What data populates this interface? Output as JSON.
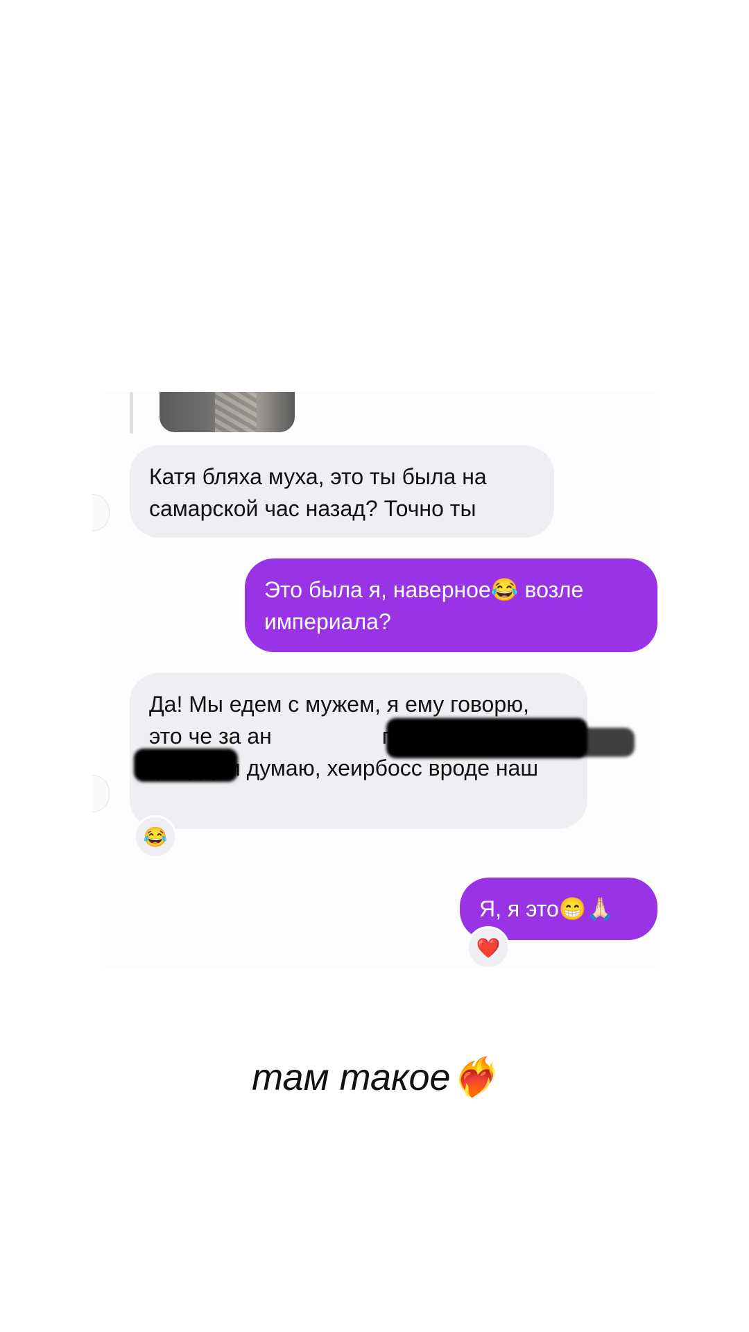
{
  "chat": {
    "messages": [
      {
        "sender": "them",
        "text": "Катя бляха муха, это ты была на самарской час назад? Точно ты"
      },
      {
        "sender": "me",
        "text": "Это была я, наверное😂 возле империала?"
      },
      {
        "sender": "them",
        "text": "Да! Мы едем с мужем, я ему говорю, это че за ан",
        "text_after_redaction": "потом смотрю на фигуру и думаю, хеирбосс вроде наш",
        "reaction": "😂"
      },
      {
        "sender": "me",
        "text": "Я, я это😁🙏🏻",
        "reaction": "❤️"
      }
    ]
  },
  "caption": {
    "text": "там такое❤️‍🔥"
  },
  "colors": {
    "outgoing_bubble": "#9834e6",
    "incoming_bubble": "#efeff3"
  }
}
